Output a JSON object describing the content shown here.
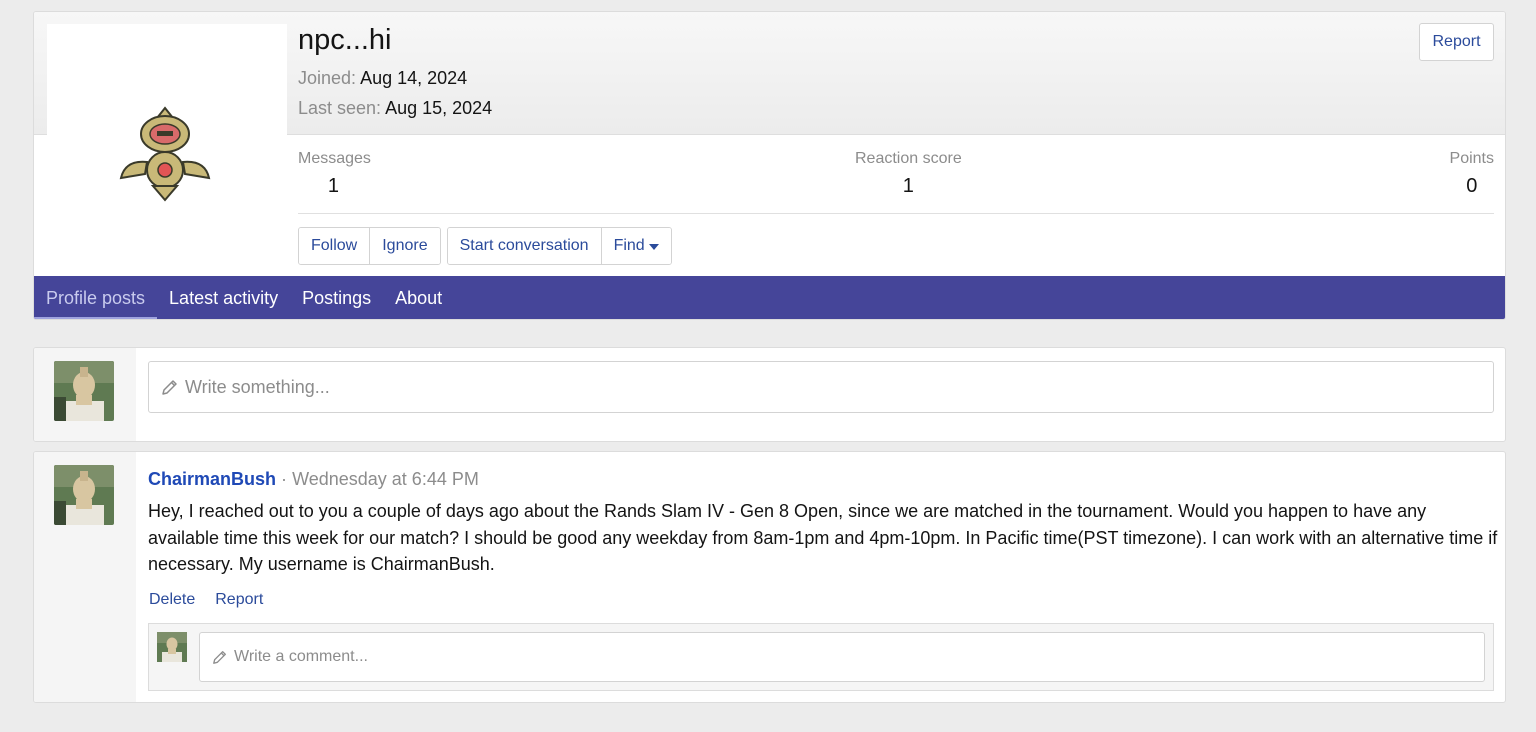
{
  "profile": {
    "name": "npc...hi",
    "joined_label": "Joined:",
    "joined_value": "Aug 14, 2024",
    "last_seen_label": "Last seen:",
    "last_seen_value": "Aug 15, 2024",
    "report_label": "Report"
  },
  "stats": {
    "messages_label": "Messages",
    "messages_value": "1",
    "reaction_label": "Reaction score",
    "reaction_value": "1",
    "points_label": "Points",
    "points_value": "0"
  },
  "actions": {
    "follow": "Follow",
    "ignore": "Ignore",
    "start_conversation": "Start conversation",
    "find": "Find"
  },
  "tabs": [
    {
      "label": "Profile posts",
      "active": true
    },
    {
      "label": "Latest activity",
      "active": false
    },
    {
      "label": "Postings",
      "active": false
    },
    {
      "label": "About",
      "active": false
    }
  ],
  "compose": {
    "placeholder": "Write something..."
  },
  "message": {
    "author": "ChairmanBush",
    "separator": "·",
    "time": "Wednesday at 6:44 PM",
    "body": "Hey, I reached out to you a couple of days ago about the Rands Slam IV - Gen 8 Open, since we are matched in the tournament. Would you happen to have any available time this week for our match? I should be good any weekday from 8am-1pm and 4pm-10pm. In Pacific time(PST timezone). I can work with an alternative time if necessary. My username is ChairmanBush.",
    "delete_label": "Delete",
    "report_label": "Report",
    "comment_placeholder": "Write a comment..."
  },
  "colors": {
    "nav_bar": "#454599",
    "link": "#2b4b9b",
    "author": "#1f49b6"
  }
}
